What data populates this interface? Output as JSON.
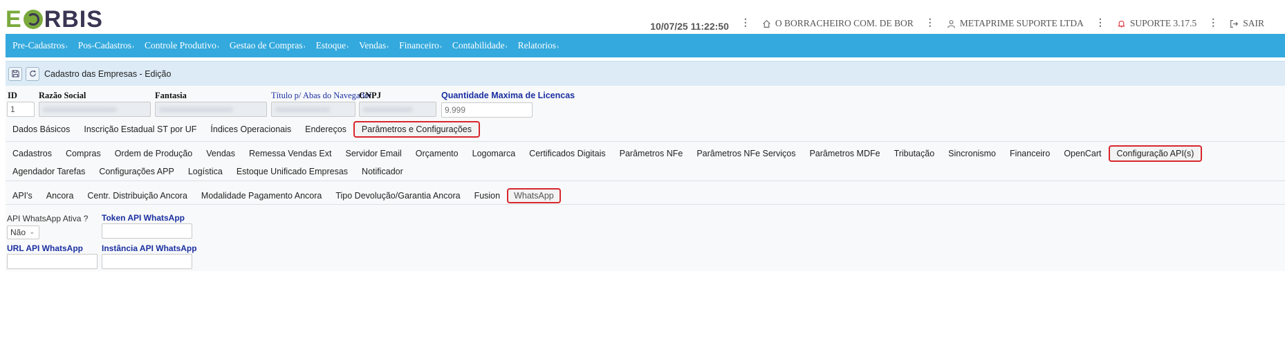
{
  "logo": {
    "text_e": "E",
    "text_rest": "RBIS"
  },
  "header": {
    "datetime": "10/07/25 11:22:50",
    "company": "O BORRACHEIRO COM. DE BOR",
    "user": "METAPRIME SUPORTE LTDA",
    "support": "SUPORTE 3.17.5",
    "logout": "SAIR"
  },
  "menu": [
    "Pre-Cadastros",
    "Pos-Cadastros",
    "Controle Produtivo",
    "Gestao de Compras",
    "Estoque",
    "Vendas",
    "Financeiro",
    "Contabilidade",
    "Relatorios"
  ],
  "menu_caret": "›",
  "title": "Cadastro das Empresas - Edição",
  "fields": {
    "id_label": "ID",
    "id_value": "1",
    "razao_label": "Razão Social",
    "fantasia_label": "Fantasia",
    "titulo_label": "Título p/ Abas do Navegador",
    "cnpj_label": "CNPJ",
    "licencas_label": "Quantidade Maxima de Licencas",
    "licencas_placeholder": "9.999"
  },
  "main_tabs": [
    "Dados Básicos",
    "Inscrição Estadual ST por UF",
    "Índices Operacionais",
    "Endereços",
    "Parâmetros e Configurações"
  ],
  "config_tabs_row1": [
    "Cadastros",
    "Compras",
    "Ordem de Produção",
    "Vendas",
    "Remessa Vendas Ext",
    "Servidor Email",
    "Orçamento",
    "Logomarca",
    "Certificados Digitais",
    "Parâmetros NFe",
    "Parâmetros NFe Serviços",
    "Parâmetros MDFe",
    "Tributação",
    "Sincronismo",
    "Financeiro",
    "OpenCart",
    "Configuração API(s)"
  ],
  "config_tabs_row2": [
    "Agendador Tarefas",
    "Configurações APP",
    "Logística",
    "Estoque Unificado Empresas",
    "Notificador"
  ],
  "api_tabs": [
    "API's",
    "Ancora",
    "Centr. Distribuição Ancora",
    "Modalidade Pagamento Ancora",
    "Tipo Devolução/Garantia Ancora",
    "Fusion",
    "WhatsApp"
  ],
  "whatsapp": {
    "active_label": "API WhatsApp Ativa ?",
    "active_value": "Não",
    "token_label": "Token API WhatsApp",
    "url_label": "URL API WhatsApp",
    "instance_label": "Instância API WhatsApp"
  },
  "colors": {
    "menubar": "#33a9dd",
    "highlight": "#d8262c",
    "label_blue": "#1a2fa0"
  }
}
